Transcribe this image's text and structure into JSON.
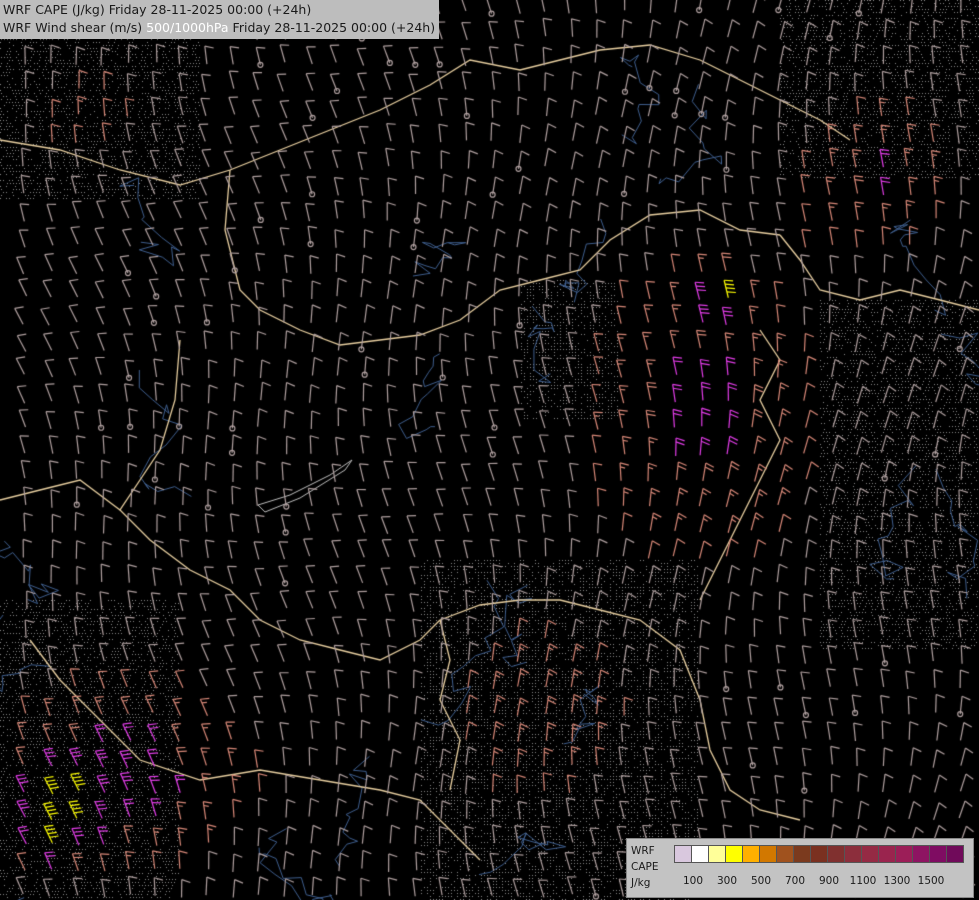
{
  "header": {
    "line1": "WRF CAPE (J/kg) Friday 28-11-2025 00:00 (+24h)",
    "line2_prefix": "WRF Wind shear (m/s) ",
    "line2_level": "500/1000hPa",
    "line2_suffix": " Friday 28-11-2025 00:00 (+24h)"
  },
  "legend": {
    "line1": "WRF",
    "line2": "CAPE",
    "line3": "J/kg",
    "colors": [
      "#d9c8de",
      "#ffffff",
      "#ffff99",
      "#ffff00",
      "#ffb000",
      "#d27800",
      "#a0521e",
      "#7b3a1e",
      "#7a3020",
      "#80302f",
      "#8c2e3c",
      "#952a44",
      "#9a244e",
      "#9c1e58",
      "#8e1462",
      "#7f0c62",
      "#700a5a"
    ],
    "ticks": [
      "100",
      "300",
      "500",
      "700",
      "900",
      "1100",
      "1300",
      "1500"
    ]
  },
  "map": {
    "description_colors": {
      "background": "#000000",
      "borders": "#e8cfa0",
      "rivers": "#3f5f8f",
      "barb_low": "#b0a0a0",
      "barb_mid": "#d88878",
      "barb_high": "#e23ce8",
      "barb_extreme": "#ffff00"
    }
  }
}
